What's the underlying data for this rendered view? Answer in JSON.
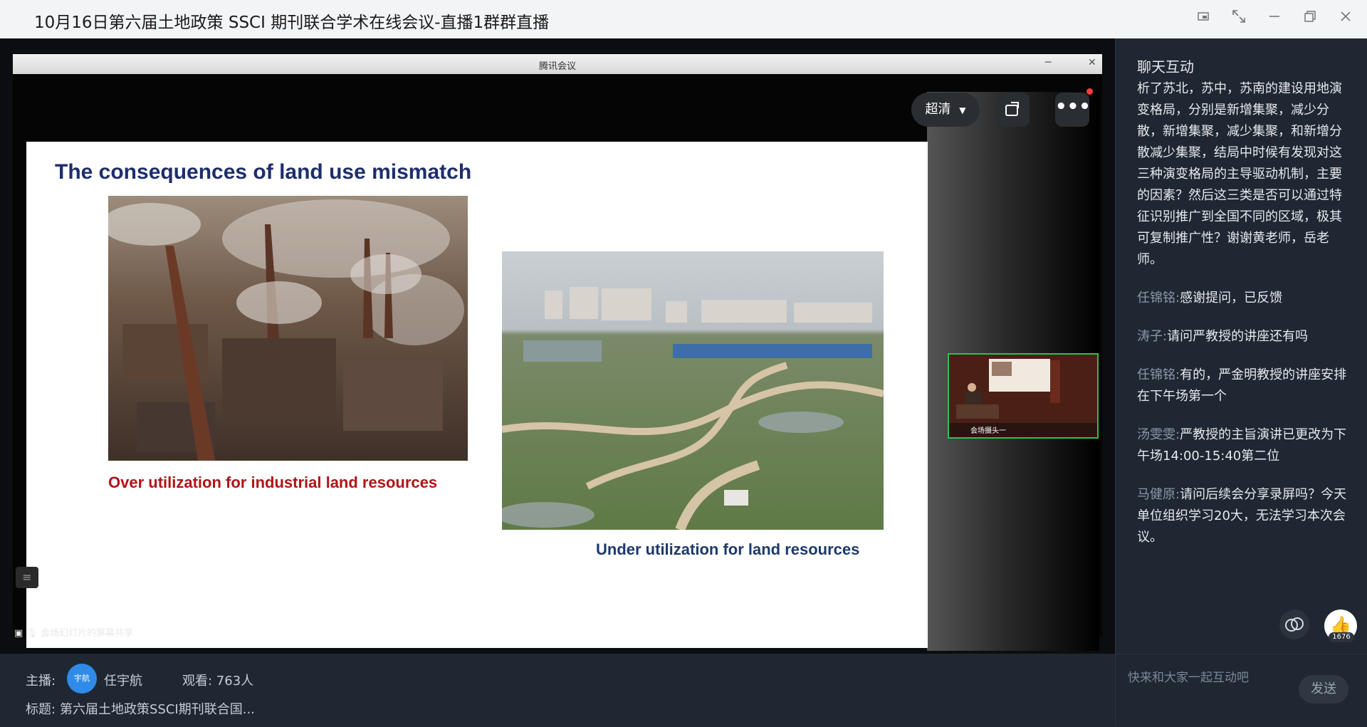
{
  "window": {
    "title": "10月16日第六届土地政策 SSCI 期刊联合学术在线会议-直播1群群直播",
    "buttons": [
      "pin-icon",
      "fullscreen-icon",
      "minimize-icon",
      "restore-icon",
      "close-icon"
    ]
  },
  "player": {
    "meeting_title": "腾讯会议",
    "quality_label": "超清",
    "share_label": "会场幻灯片的屏幕共享",
    "pip_label": "会场摄头一"
  },
  "slide": {
    "title": "The consequences of land use mismatch",
    "caption_left": "Over utilization for industrial land resources",
    "caption_right": "Under utilization for land resources"
  },
  "info": {
    "host_label": "主播:",
    "host_avatar_text": "宇航",
    "host_name": "任宇航",
    "viewers": "观看: 763人",
    "topic_label": "标题:",
    "topic": "第六届土地政策SSCI期刊联合国..."
  },
  "chat": {
    "title": "聊天互动",
    "messages": [
      {
        "name": "",
        "text": "析了苏北，苏中，苏南的建设用地演变格局，分别是新增集聚，减少分散，新增集聚，减少集聚，和新增分散减少集聚，结局中时候有发现对这三种演变格局的主导驱动机制，主要的因素？然后这三类是否可以通过特征识别推广到全国不同的区域，极其可复制推广性？谢谢黄老师，岳老师。"
      },
      {
        "name": "任锦铭:",
        "text": "感谢提问，已反馈"
      },
      {
        "name": "涛子:",
        "text": "请问严教授的讲座还有吗"
      },
      {
        "name": "任锦铭:",
        "text": "有的，严金明教授的讲座安排在下午场第一个"
      },
      {
        "name": "汤雯雯:",
        "text": "严教授的主旨演讲已更改为下午场14:00-15:40第二位"
      },
      {
        "name": "马健原:",
        "text": "请问后续会分享录屏吗？今天单位组织学习20大，无法学习本次会议。"
      }
    ],
    "like_count": "1676",
    "input_placeholder": "快来和大家一起互动吧",
    "send_label": "发送"
  }
}
